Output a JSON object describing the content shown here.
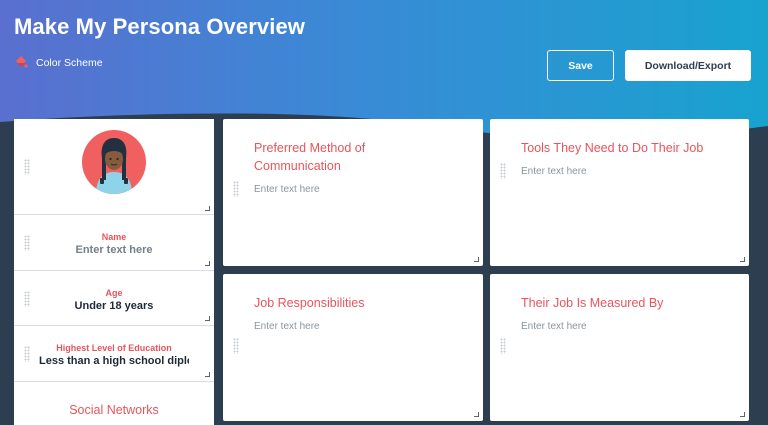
{
  "header": {
    "title": "Make My Persona Overview",
    "color_scheme_label": "Color Scheme",
    "save_label": "Save",
    "export_label": "Download/Export"
  },
  "sidebar": {
    "name_label": "Name",
    "name_value": "Enter text here",
    "age_label": "Age",
    "age_value": "Under 18 years",
    "education_label": "Highest Level of Education",
    "education_value": "Less than a high school diploma",
    "social_label": "Social Networks"
  },
  "cards": [
    {
      "title_line1": "Preferred Method of",
      "title_line2": "Communication",
      "placeholder": "Enter text here"
    },
    {
      "title_line1": "Tools They Need to Do Their Job",
      "title_line2": "",
      "placeholder": "Enter text here"
    },
    {
      "title_line1": "Job Responsibilities",
      "title_line2": "",
      "placeholder": "Enter text here"
    },
    {
      "title_line1": "Their Job Is Measured By",
      "title_line2": "",
      "placeholder": "Enter text here"
    }
  ],
  "colors": {
    "accent": "#e8545b",
    "background": "#2d3e50",
    "header_gradient_start": "#5a6fcf",
    "header_gradient_end": "#18a3cf"
  },
  "icons": {
    "color_scheme": "paint-bucket-icon",
    "drag": "drag-handle-icon",
    "resize": "resize-handle-icon"
  }
}
